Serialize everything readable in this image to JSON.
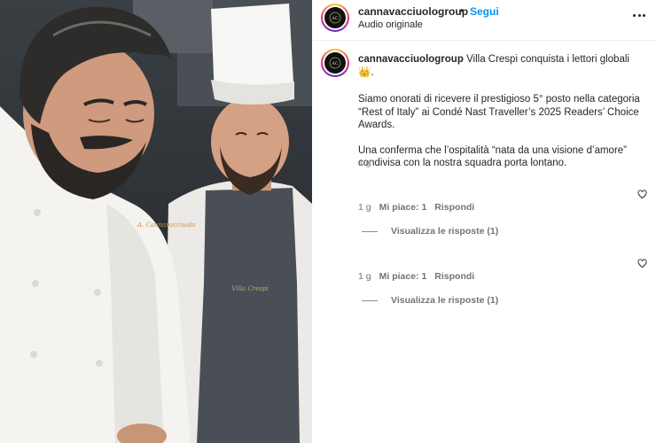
{
  "header": {
    "username": "cannavacciuologroup",
    "separator": "•",
    "follow_label": "Segui",
    "audio": "Audio originale"
  },
  "caption": {
    "username": "cannavacciuologroup",
    "title": "Villa Crespi conquista i lettori globali",
    "title_emoji": "👑",
    "paragraph_1": "Siamo onorati di ricevere il prestigioso 5° posto nella categoria “Rest of Italy” ai Condé Nast Traveller’s 2025 Readers’ Choice Awards.",
    "paragraph_2": "Una conferma che l’ospitalità “nata da una visione d’amore” condivisa con la nostra squadra porta lontano.",
    "time": "1 g"
  },
  "comments": [
    {
      "time": "1 g",
      "likes": "Mi piace: 1",
      "reply_label": "Rispondi",
      "view_replies": "Visualizza le risposte (1)"
    },
    {
      "time": "1 g",
      "likes": "Mi piace: 1",
      "reply_label": "Rispondi",
      "view_replies": "Visualizza le risposte (1)"
    }
  ],
  "photo": {
    "jacket_text": "A. Cannavacciuolo",
    "apron_text": "Villa Crespi"
  },
  "colors": {
    "follow": "#0095f6",
    "text": "#262626",
    "muted": "#737373"
  },
  "icons": [
    "more-options-icon",
    "heart-icon",
    "crown-emoji"
  ]
}
